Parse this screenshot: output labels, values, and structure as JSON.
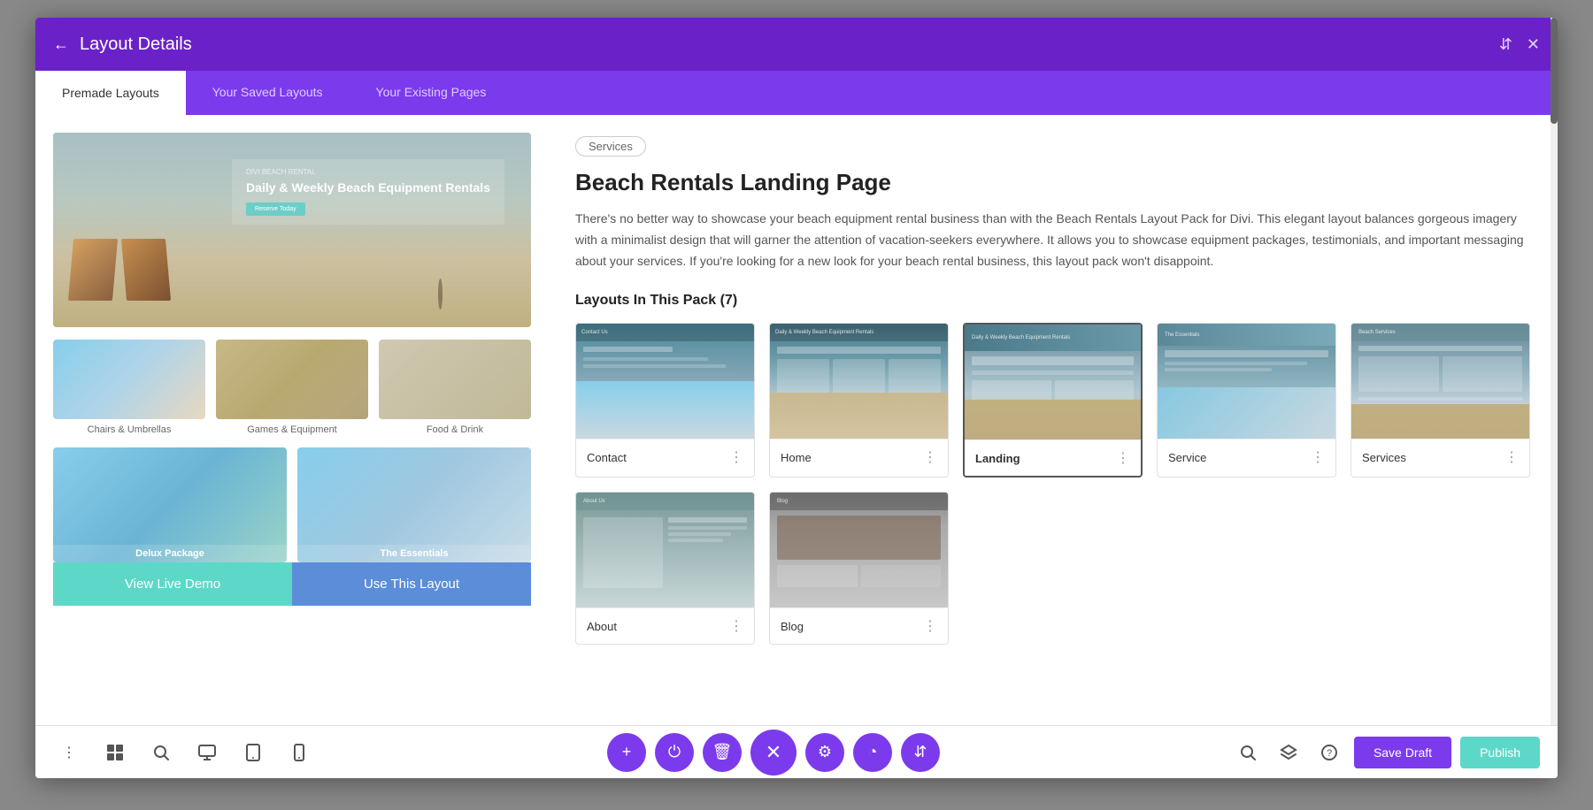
{
  "modal": {
    "title": "Layout Details",
    "tabs": [
      {
        "label": "Premade Layouts",
        "active": true
      },
      {
        "label": "Your Saved Layouts",
        "active": false
      },
      {
        "label": "Your Existing Pages",
        "active": false
      }
    ]
  },
  "left_panel": {
    "view_live_demo": "View Live Demo",
    "use_this_layout": "Use This Layout",
    "small_previews": [
      {
        "label": "Chairs & Umbrellas"
      },
      {
        "label": "Games & Equipment"
      },
      {
        "label": "Food & Drink"
      }
    ],
    "packages": [
      {
        "label": "Delux Package"
      },
      {
        "label": "The Essentials"
      }
    ]
  },
  "right_panel": {
    "category": "Services",
    "title": "Beach Rentals Landing Page",
    "description": "There's no better way to showcase your beach equipment rental business than with the Beach Rentals Layout Pack for Divi. This elegant layout balances gorgeous imagery with a minimalist design that will garner the attention of vacation-seekers everywhere. It allows you to showcase equipment packages, testimonials, and important messaging about your services. If you're looking for a new look for your beach rental business, this layout pack won't disappoint.",
    "layouts_count_label": "Layouts In This Pack (7)",
    "layouts": [
      {
        "name": "Contact",
        "type": "contact"
      },
      {
        "name": "Home",
        "type": "home"
      },
      {
        "name": "Landing",
        "type": "landing",
        "bold": true
      },
      {
        "name": "Service",
        "type": "service"
      },
      {
        "name": "Services",
        "type": "services"
      },
      {
        "name": "About",
        "type": "about"
      },
      {
        "name": "Blog",
        "type": "blog"
      }
    ]
  },
  "toolbar": {
    "save_draft": "Save Draft",
    "publish": "Publish"
  },
  "preview_card": {
    "small_text": "DIVI BEACH RENTAL",
    "title": "Daily & Weekly Beach Equipment Rentals",
    "btn": "Reserve Today"
  }
}
